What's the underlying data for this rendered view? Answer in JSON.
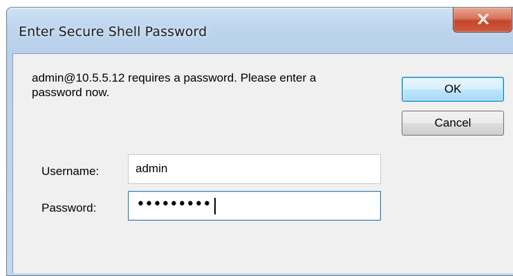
{
  "dialog": {
    "title": "Enter Secure Shell Password",
    "close_icon": "close-x-icon",
    "message": "admin@10.5.5.12 requires a password.  Please enter a password now.",
    "buttons": {
      "ok_label": "OK",
      "cancel_label": "Cancel"
    },
    "fields": {
      "username_label": "Username:",
      "username_value": "admin",
      "password_label": "Password:",
      "password_masked": "•••••••••"
    },
    "colors": {
      "close_button": "#c5442a",
      "focus_border": "#3d7bad",
      "client_background": "#f0f0f0"
    }
  }
}
